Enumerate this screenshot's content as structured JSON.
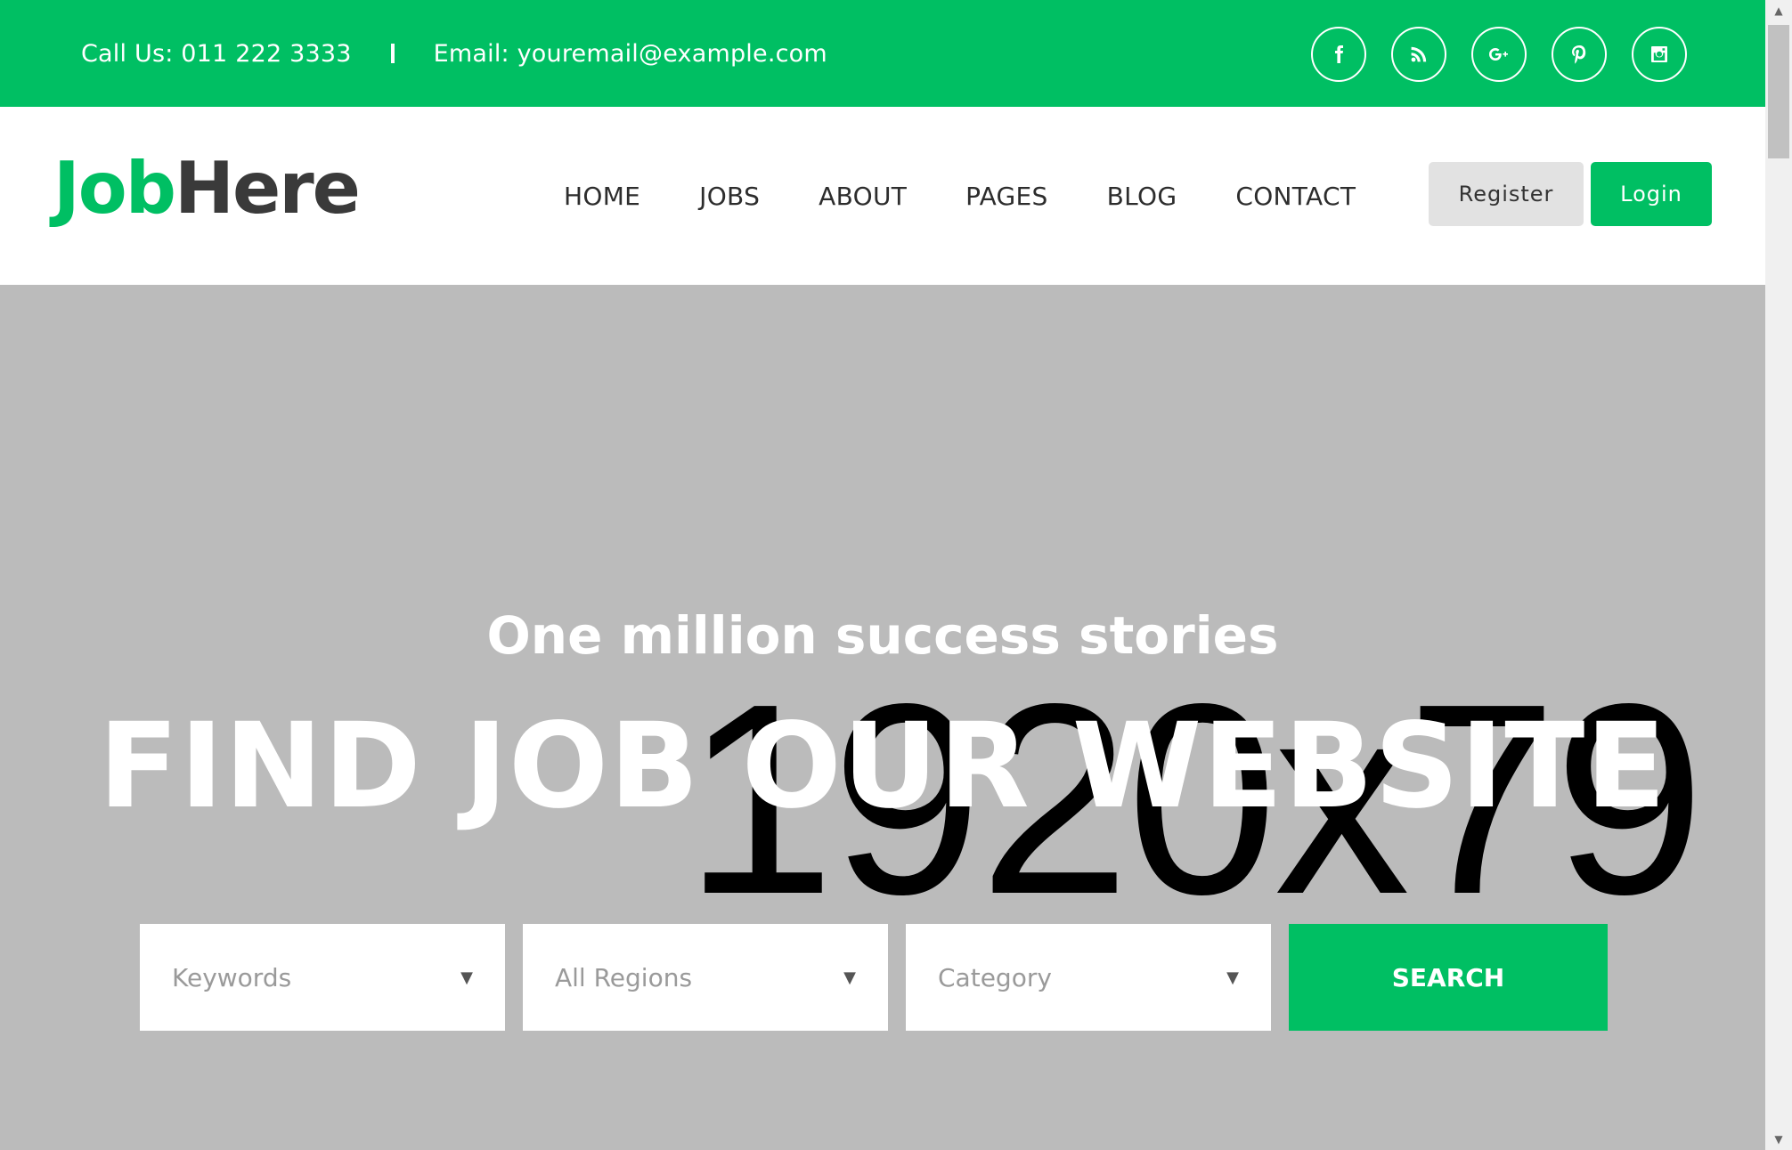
{
  "topbar": {
    "call": "Call Us: 011 222 3333",
    "email": "Email: youremail@example.com",
    "social": [
      "facebook-icon",
      "rss-icon",
      "google-plus-icon",
      "pinterest-icon",
      "instagram-icon"
    ]
  },
  "header": {
    "logo_part1": "Job",
    "logo_part2": "Here",
    "nav": [
      "HOME",
      "JOBS",
      "ABOUT",
      "PAGES",
      "BLOG",
      "CONTACT"
    ],
    "register": "Register",
    "login": "Login"
  },
  "hero": {
    "placeholder_text": "1920x79",
    "subtitle": "One million success stories",
    "headline": "FIND JOB OUR WEBSITE",
    "search": {
      "keywords": "Keywords",
      "regions": "All Regions",
      "category": "Category",
      "button": "SEARCH"
    }
  },
  "colors": {
    "brand_green": "#00bf63",
    "hero_bg": "#bbbbbb"
  }
}
